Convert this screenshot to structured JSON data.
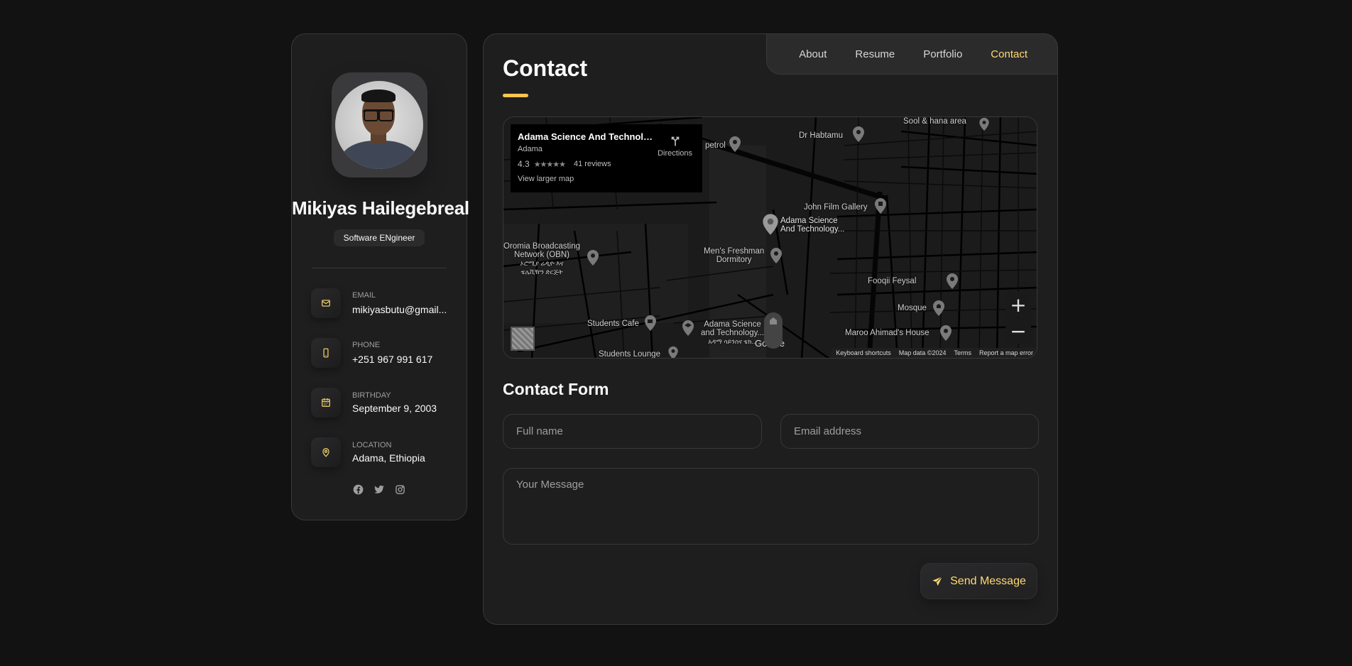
{
  "profile": {
    "name": "Mikiyas Hailegebreal",
    "title": "Software ENgineer"
  },
  "contacts": [
    {
      "label": "Email",
      "value": "mikiyasbutu@gmail...",
      "icon": "mail-icon"
    },
    {
      "label": "Phone",
      "value": "+251 967 991 617",
      "icon": "phone-icon"
    },
    {
      "label": "Birthday",
      "value": "September 9, 2003",
      "icon": "calendar-icon"
    },
    {
      "label": "Location",
      "value": "Adama, Ethiopia",
      "icon": "location-pin-icon"
    }
  ],
  "socials": [
    "facebook-icon",
    "twitter-icon",
    "instagram-icon"
  ],
  "nav": {
    "items": [
      "About",
      "Resume",
      "Portfolio",
      "Contact"
    ],
    "active": "Contact"
  },
  "page": {
    "title": "Contact"
  },
  "map": {
    "place_name": "Adama Science And Technolo...",
    "place_city": "Adama",
    "rating": "4.3",
    "reviews": "41 reviews",
    "larger_map": "View larger map",
    "directions": "Directions",
    "labels": {
      "petrol": "petrol",
      "dr_habtamu": "Dr Habtamu",
      "sool": "Sool & hana area",
      "john_film": "John Film Gallery",
      "astu_1": "Adama Science",
      "astu_2": "And Technology...",
      "obn_1": "Oromia Broadcasting",
      "obn_2": "Network (OBN)",
      "obn_3": "ኦሮሚያ ሬዲዮ እና",
      "obn_4": "ቴሌቪዥን ድርጅት",
      "freshman_1": "Men's Freshman",
      "freshman_2": "Dormitory",
      "fooqii": "Fooqii Feysal",
      "mosque": "Mosque",
      "students_cafe": "Students Cafe",
      "astu_b1": "Adama Science",
      "astu_b2": "and Technology...",
      "astu_b3": "አዳማ ሳይንስና ቴክ...",
      "maroo": "Maroo Ahimad's House",
      "students_lounge": "Students Lounge",
      "google": "Google"
    },
    "footer": [
      "Keyboard shortcuts",
      "Map data ©2024",
      "Terms",
      "Report a map error"
    ],
    "zoom_in": "+",
    "zoom_out": "−"
  },
  "form": {
    "title": "Contact Form",
    "name_placeholder": "Full name",
    "email_placeholder": "Email address",
    "message_placeholder": "Your Message",
    "submit": "Send Message"
  },
  "colors": {
    "accent": "#ffdb70",
    "background": "#121212",
    "card": "#1e1e1f"
  }
}
